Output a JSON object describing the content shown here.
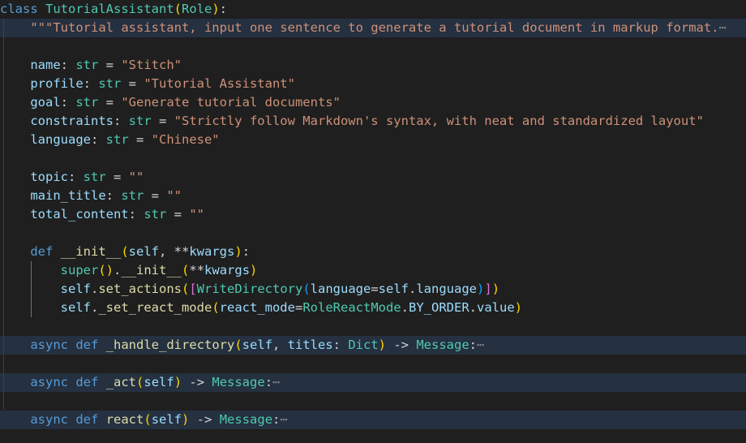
{
  "editor": {
    "language": "python",
    "background_color": "#1f1f1f",
    "folded_line_background": "#253040",
    "font_size_px": 15.5,
    "line_height_px": 23,
    "indent_guide_color": "#404040",
    "active_indent_guide_color": "#707070",
    "fold_ellipsis": "⋯",
    "scrolled_off_partial_text": "    \"\"\""
  },
  "colors": {
    "keyword": "#569cd6",
    "type": "#4ec9b0",
    "function": "#dcdcaa",
    "variable": "#9cdcfe",
    "string": "#ce9178",
    "operator": "#d4d4d4",
    "bracket_level_1": "#ffd700",
    "bracket_level_2": "#da70d6",
    "bracket_level_3": "#179fff",
    "fold_indicator": "#8a8a8a"
  },
  "code": {
    "class_name": "TutorialAssistant",
    "base_class": "Role",
    "docstring": "Tutorial assistant, input one sentence to generate a tutorial document in markup format.",
    "attributes": [
      {
        "name": "name",
        "type": "str",
        "value": "\"Stitch\""
      },
      {
        "name": "profile",
        "type": "str",
        "value": "\"Tutorial Assistant\""
      },
      {
        "name": "goal",
        "type": "str",
        "value": "\"Generate tutorial documents\""
      },
      {
        "name": "constraints",
        "type": "str",
        "value": "\"Strictly follow Markdown's syntax, with neat and standardized layout\""
      },
      {
        "name": "language",
        "type": "str",
        "value": "\"Chinese\""
      },
      {
        "name": "topic",
        "type": "str",
        "value": "\"\""
      },
      {
        "name": "main_title",
        "type": "str",
        "value": "\"\""
      },
      {
        "name": "total_content",
        "type": "str",
        "value": "\"\""
      }
    ],
    "init": {
      "keyword": "def",
      "name": "__init__",
      "params": "self, **kwargs",
      "body": [
        "super().__init__(**kwargs)",
        "self.set_actions([WriteDirectory(language=self.language)])",
        "self._set_react_mode(react_mode=RoleReactMode.BY_ORDER.value)"
      ]
    },
    "folded_methods": [
      {
        "async": "async",
        "keyword": "def",
        "name": "_handle_directory",
        "params": "self, titles: Dict",
        "returns": "Message"
      },
      {
        "async": "async",
        "keyword": "def",
        "name": "_act",
        "params": "self",
        "returns": "Message"
      },
      {
        "async": "async",
        "keyword": "def",
        "name": "react",
        "params": "self",
        "returns": "Message"
      }
    ]
  },
  "lines": [
    {
      "id": "line-class-def",
      "folded": false,
      "indent": 0
    },
    {
      "id": "line-docstring",
      "folded": true,
      "indent": 1
    },
    {
      "id": "line-blank-1",
      "folded": false,
      "indent": 0
    },
    {
      "id": "line-attr-name",
      "folded": false,
      "indent": 1
    },
    {
      "id": "line-attr-profile",
      "folded": false,
      "indent": 1
    },
    {
      "id": "line-attr-goal",
      "folded": false,
      "indent": 1
    },
    {
      "id": "line-attr-constraints",
      "folded": false,
      "indent": 1
    },
    {
      "id": "line-attr-language",
      "folded": false,
      "indent": 1
    },
    {
      "id": "line-blank-2",
      "folded": false,
      "indent": 0
    },
    {
      "id": "line-attr-topic",
      "folded": false,
      "indent": 1
    },
    {
      "id": "line-attr-main-title",
      "folded": false,
      "indent": 1
    },
    {
      "id": "line-attr-total",
      "folded": false,
      "indent": 1
    },
    {
      "id": "line-blank-3",
      "folded": false,
      "indent": 0
    },
    {
      "id": "line-init-def",
      "folded": false,
      "indent": 1
    },
    {
      "id": "line-init-super",
      "folded": false,
      "indent": 2
    },
    {
      "id": "line-init-actions",
      "folded": false,
      "indent": 2
    },
    {
      "id": "line-init-reactmode",
      "folded": false,
      "indent": 2
    },
    {
      "id": "line-blank-4",
      "folded": false,
      "indent": 0
    },
    {
      "id": "line-handle-directory",
      "folded": true,
      "indent": 1
    },
    {
      "id": "line-blank-5",
      "folded": false,
      "indent": 0
    },
    {
      "id": "line-act",
      "folded": true,
      "indent": 1
    },
    {
      "id": "line-blank-6",
      "folded": false,
      "indent": 0
    },
    {
      "id": "line-react",
      "folded": true,
      "indent": 1
    }
  ],
  "text": {
    "kw_class": "class",
    "kw_def": "def",
    "kw_async": "async",
    "kw_super": "super",
    "kw_self": "self",
    "kw_kwargs": "kwargs",
    "kw_str": "str",
    "kw_dict": "Dict",
    "kw_message": "Message",
    "kw_init": "__init__",
    "sym_colon": ":",
    "sym_eq": " = ",
    "sym_arrow": " -> ",
    "sym_dot": ".",
    "sym_comma": ", ",
    "sym_stars": "**",
    "indent1": "    ",
    "indent2": "        ",
    "docstring_quotes": "\"\"\"",
    "fold_dots": "⋯",
    "set_actions": "set_actions",
    "write_directory": "WriteDirectory",
    "language_kw": "language",
    "set_react_mode": "_set_react_mode",
    "react_mode_kw": "react_mode",
    "role_react_mode": "RoleReactMode",
    "by_order": "BY_ORDER",
    "value_attr": "value",
    "handle_directory": "_handle_directory",
    "act": "_act",
    "react": "react",
    "titles": "titles"
  }
}
